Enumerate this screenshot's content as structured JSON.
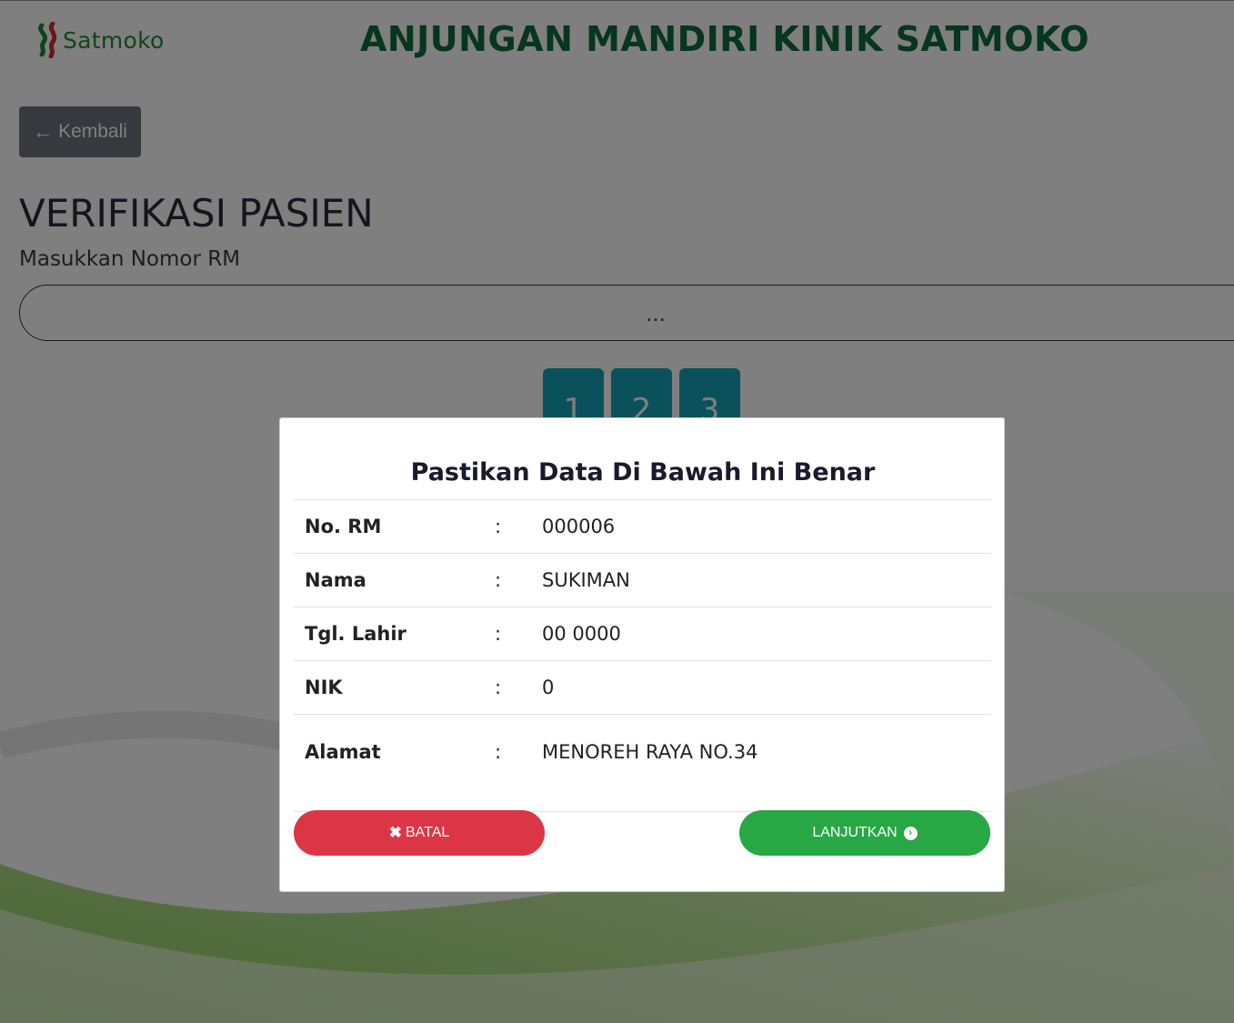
{
  "header": {
    "logo_text": "Satmoko",
    "title": "ANJUNGAN MANDIRI KINIK SATMOKO"
  },
  "back_button": {
    "label": "Kembali"
  },
  "page": {
    "title": "VERIFIKASI PASIEN",
    "subtitle": "Masukkan Nomor RM",
    "rm_input_value": "..."
  },
  "numpad": {
    "keys": [
      "1",
      "2",
      "3"
    ]
  },
  "modal": {
    "title": "Pastikan Data Di Bawah Ini Benar",
    "separator": ":",
    "rows": [
      {
        "label": "No. RM",
        "value": "000006"
      },
      {
        "label": "Nama",
        "value": "SUKIMAN"
      },
      {
        "label": "Tgl. Lahir",
        "value": "00 0000"
      },
      {
        "label": "NIK",
        "value": "0"
      },
      {
        "label": "Alamat",
        "value": "MENOREH RAYA NO.34"
      }
    ],
    "cancel_label": "BATAL",
    "continue_label": "LANJUTKAN"
  },
  "colors": {
    "brand_green": "#0f6a3a",
    "cancel_red": "#dc3545",
    "continue_green": "#28a745",
    "key_teal": "#17a2b8",
    "back_gray": "#6c757d"
  },
  "icons": {
    "back": "arrow-left-icon",
    "cancel": "close-icon",
    "continue": "chevron-circle-right-icon",
    "logo": "satmoko-logo-mark"
  }
}
